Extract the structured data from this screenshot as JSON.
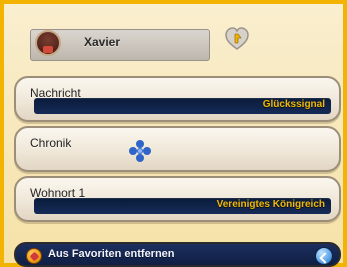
{
  "header": {
    "player_name": "Xavier"
  },
  "cards": [
    {
      "title": "Nachricht",
      "value": "Glückssignal"
    },
    {
      "title": "Chronik",
      "value": ""
    },
    {
      "title": "Wohnort 1",
      "value": "Vereinigtes Königreich"
    }
  ],
  "footer": {
    "remove_favorite_label": "Aus Favoriten entfernen"
  },
  "icons": {
    "avatar": "player-avatar",
    "favorite": "favorite-heart-icon",
    "chronik": "blue-flower-icon",
    "remove": "remove-favorite-icon",
    "back": "back-arrow-icon"
  },
  "colors": {
    "frame_accent": "#f2b400",
    "value_text": "#f2b800",
    "value_bg": "#0b1c3b"
  }
}
